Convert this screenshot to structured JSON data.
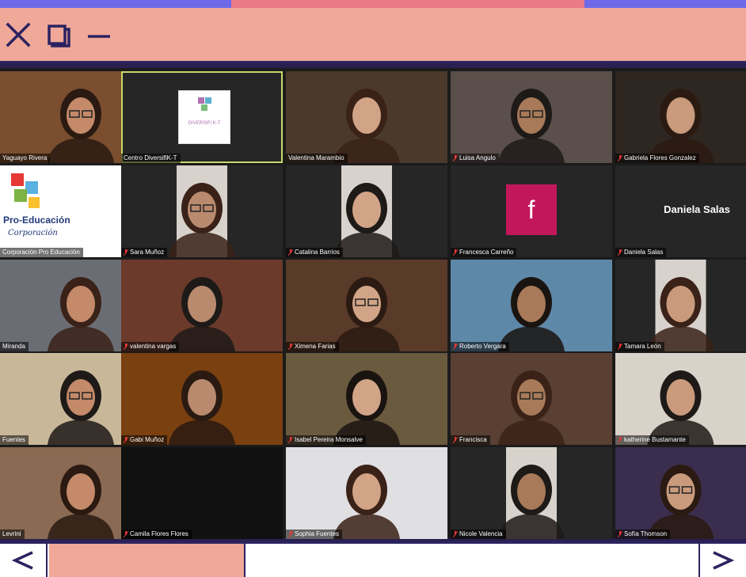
{
  "window": {
    "controls": [
      {
        "icon": "close-icon"
      },
      {
        "icon": "maximize-icon"
      },
      {
        "icon": "minimize-icon"
      }
    ]
  },
  "colors": {
    "titlebar": "#f0a898",
    "accent_blue": "#6e6aea",
    "accent_pink": "#ea7a86",
    "frame": "#2b2360",
    "active_speaker": "#c9d86a"
  },
  "participants": [
    {
      "name": "Yaguayo Rivera",
      "muted": false
    },
    {
      "name": "Centro DiversifiK-T",
      "muted": false,
      "active": true
    },
    {
      "name": "Valentina Marambio",
      "muted": false
    },
    {
      "name": "Luisa Angulo",
      "muted": true
    },
    {
      "name": "Gabriela Flores Gonzalez",
      "muted": true
    },
    {
      "name": "Corporación Pro Educación",
      "muted": false
    },
    {
      "name": "Sara Muñoz",
      "muted": true
    },
    {
      "name": "Catalina Barrios",
      "muted": true
    },
    {
      "name": "Francesca Carreño",
      "muted": true
    },
    {
      "name": "Daniela Salas",
      "muted": true
    },
    {
      "name": "Miranda",
      "muted": false
    },
    {
      "name": "valentina vargas",
      "muted": true
    },
    {
      "name": "Ximena Farias",
      "muted": true
    },
    {
      "name": "Roberto Vergara",
      "muted": true
    },
    {
      "name": "Tamara León",
      "muted": true
    },
    {
      "name": "Fuentes",
      "muted": false
    },
    {
      "name": "Gabi Muñoz",
      "muted": true
    },
    {
      "name": "Isabel Pereira Monsalve",
      "muted": true
    },
    {
      "name": "Francisca",
      "muted": true
    },
    {
      "name": "katherine Bustamante",
      "muted": true
    },
    {
      "name": "Levrini",
      "muted": false
    },
    {
      "name": "Camila Flores Flores",
      "muted": true
    },
    {
      "name": "Sophia Fuentes",
      "muted": true
    },
    {
      "name": "Nicole Valencia",
      "muted": true
    },
    {
      "name": "Sofía Thomson",
      "muted": true
    }
  ],
  "cards": {
    "diversifik_logo": "DIVERSIFI K-T",
    "f_letter": "f",
    "daniela_card": "Daniela Salas",
    "pro_title": "Pro-Educación",
    "pro_sub": "Corporación"
  },
  "nav": {
    "prev_icon": "chevron-left-icon",
    "next_icon": "chevron-right-icon"
  }
}
